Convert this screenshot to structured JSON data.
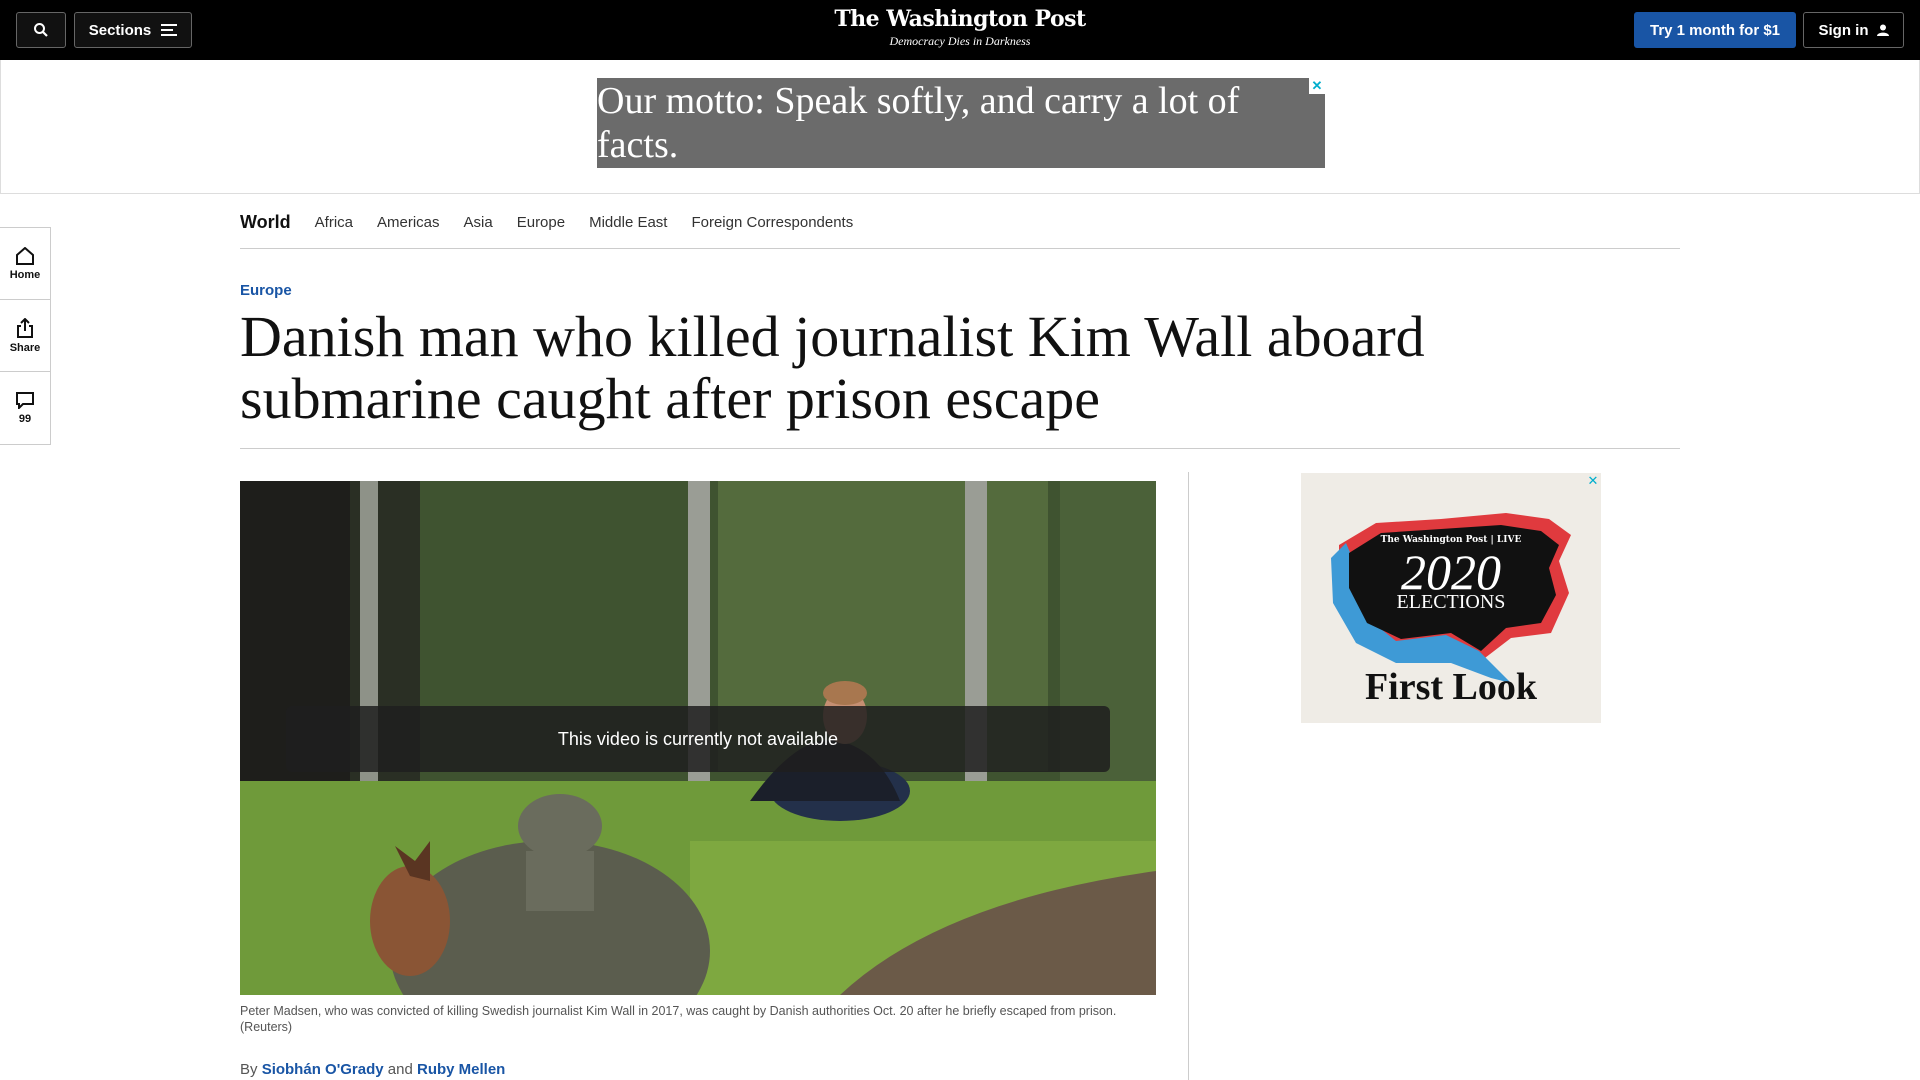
{
  "header": {
    "sections_label": "Sections",
    "logo_name": "The Washington Post",
    "logo_tagline": "Democracy Dies in Darkness",
    "try_label": "Try 1 month for $1",
    "signin_label": "Sign in"
  },
  "ads": {
    "top_text": "Our motto: Speak softly, and carry a lot of facts.",
    "close_glyph": "✕",
    "side": {
      "brand": "The Washington Post | LIVE",
      "year": "2020",
      "title": "ELECTIONS",
      "subtitle": "First Look"
    }
  },
  "subnav": {
    "section": "World",
    "items": [
      "Africa",
      "Americas",
      "Asia",
      "Europe",
      "Middle East",
      "Foreign Correspondents"
    ]
  },
  "rail": {
    "home_label": "Home",
    "share_label": "Share",
    "comments_count": "99"
  },
  "article": {
    "kicker": "Europe",
    "headline": "Danish man who killed journalist Kim Wall aboard submarine caught after prison escape",
    "video_message": "This video is currently not available",
    "caption": "Peter Madsen, who was convicted of killing Swedish journalist Kim Wall in 2017, was caught by Danish authorities Oct. 20 after he briefly escaped from prison. (Reuters)",
    "byline_prefix": "By",
    "author1": "Siobhán O'Grady",
    "byline_and": "and",
    "author2": "Ruby Mellen"
  },
  "colors": {
    "accent": "#1955a5",
    "header_bg": "#000000"
  }
}
